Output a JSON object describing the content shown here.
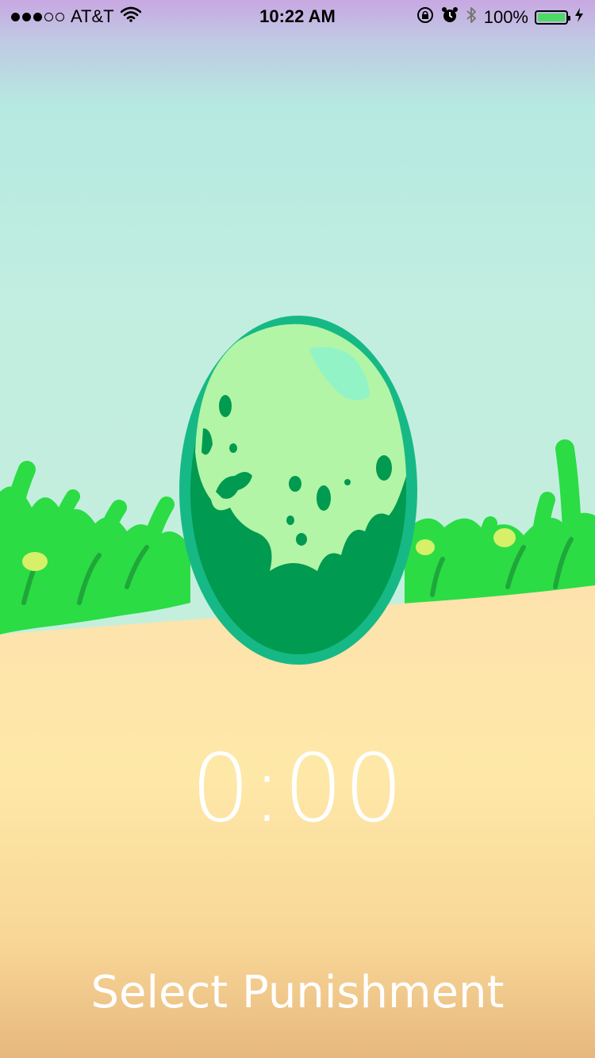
{
  "status_bar": {
    "carrier": "AT&T",
    "time": "10:22 AM",
    "battery_percent": "100%",
    "battery_level": 1.0,
    "signal_strength": 3,
    "signal_max": 5,
    "icons": [
      "signal-dots-icon",
      "wifi-icon",
      "rotation-lock-icon",
      "alarm-icon",
      "bluetooth-icon",
      "battery-icon",
      "charging-bolt-icon"
    ]
  },
  "main": {
    "timer_text": "0:00",
    "punishment_button_label": "Select Punishment"
  },
  "colors": {
    "sky_top": "#c9a9e3",
    "sky_mid": "#b7e8e2",
    "sky_low": "#c3efdf",
    "sand": "#fde6a8",
    "sand_bottom": "#e9bb80",
    "grass": "#2bdc45",
    "egg_outline": "#16b985",
    "egg_light": "#b2f5a6",
    "egg_dark": "#009a50",
    "battery_green": "#4cd964"
  }
}
